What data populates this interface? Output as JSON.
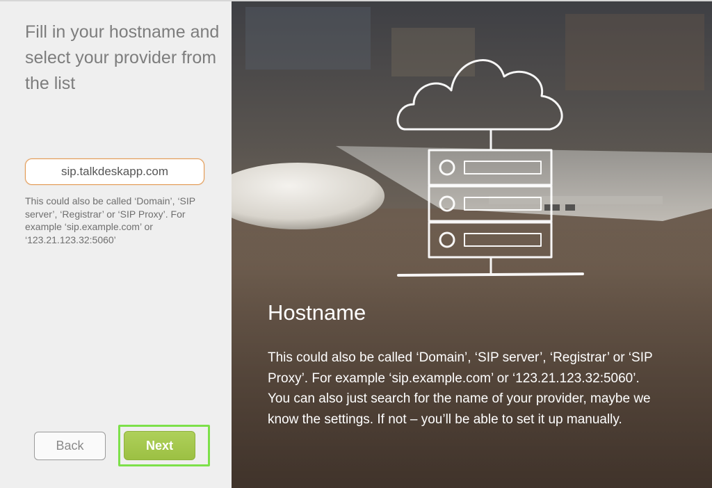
{
  "left_panel": {
    "instruction": "Fill in your hostname and select your provider from the list",
    "hostname_value": "sip.talkdeskapp.com",
    "hint": "This could also be called ‘Domain’, ‘SIP server’, ‘Registrar’ or ‘SIP Proxy’. For example ‘sip.example.com’ or ‘123.21.123.32:5060’"
  },
  "buttons": {
    "back_label": "Back",
    "next_label": "Next"
  },
  "info_panel": {
    "title": "Hostname",
    "paragraph_1": " This could also be called ‘Domain’, ‘SIP server’, ‘Registrar’ or ‘SIP Proxy’. For example ‘sip.example.com’ or ‘123.21.123.32:5060’.",
    "paragraph_2": "You can also just search for the name of your provider, maybe we know the settings. If not – you’ll be able to set it up manually."
  },
  "icons": {
    "illustration": "cloud-server-icon"
  },
  "colors": {
    "accent_orange": "#e39a54",
    "next_green": "#a5c84e",
    "focus_green": "#7de04a"
  }
}
